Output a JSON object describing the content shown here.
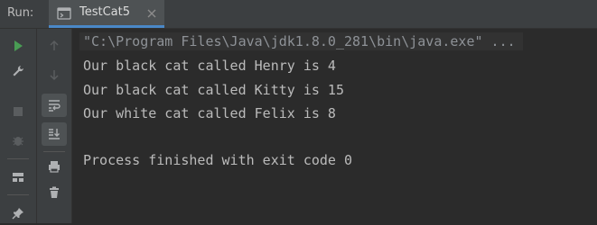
{
  "header": {
    "run_label": "Run:",
    "tab": {
      "title": "TestCat5",
      "icon": "console-tab-icon",
      "close_icon": "close-icon"
    }
  },
  "left_toolbar": [
    {
      "name": "rerun-icon",
      "active": true
    },
    {
      "name": "wrench-icon",
      "active": true
    },
    {
      "name": "stop-icon",
      "active": false
    },
    {
      "name": "debug-icon",
      "active": false
    },
    {
      "name": "layout-icon",
      "active": true
    },
    {
      "name": "pin-icon",
      "active": true
    }
  ],
  "right_toolbar": [
    {
      "name": "arrow-up-icon",
      "active": false
    },
    {
      "name": "arrow-down-icon",
      "active": false
    },
    {
      "name": "soft-wrap-icon",
      "active": true,
      "toggled": true
    },
    {
      "name": "scroll-to-end-icon",
      "active": true,
      "toggled": true
    },
    {
      "name": "print-icon",
      "active": true
    },
    {
      "name": "trash-icon",
      "active": true
    }
  ],
  "console": {
    "command_line": "\"C:\\Program Files\\Java\\jdk1.8.0_281\\bin\\java.exe\" ...",
    "lines": [
      "Our black cat called Henry is 4",
      "Our black cat called Kitty is 15",
      "Our white cat called Felix is 8"
    ],
    "exit_message": "Process finished with exit code 0"
  },
  "colors": {
    "rerun_green": "#499c54",
    "accent_blue": "#4a88c7",
    "text": "#bbbbbb",
    "command_text": "#8e9297"
  }
}
